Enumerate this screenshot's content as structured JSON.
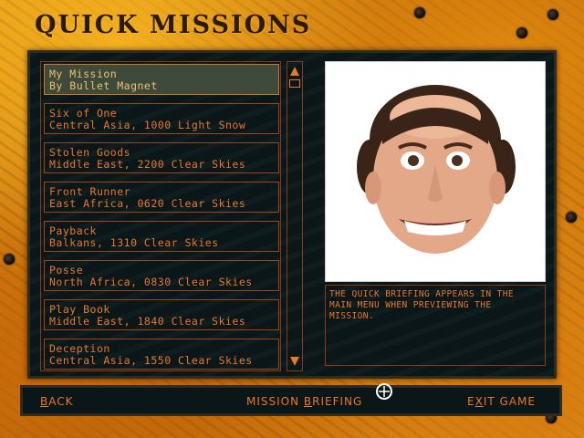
{
  "title": "QUICK MISSIONS",
  "missions": [
    {
      "name": "My Mission",
      "details": "By Bullet Magnet",
      "selected": true
    },
    {
      "name": "Six of One",
      "details": "Central Asia, 1000 Light Snow",
      "selected": false
    },
    {
      "name": "Stolen Goods",
      "details": "Middle East, 2200 Clear Skies",
      "selected": false
    },
    {
      "name": "Front Runner",
      "details": "East Africa, 0620 Clear Skies",
      "selected": false
    },
    {
      "name": "Payback",
      "details": "Balkans, 1310 Clear Skies",
      "selected": false
    },
    {
      "name": "Posse",
      "details": "North Africa, 0830 Clear Skies",
      "selected": false
    },
    {
      "name": "Play Book",
      "details": "Middle East, 1840 Clear Skies",
      "selected": false
    },
    {
      "name": "Deception",
      "details": "Central Asia, 1550 Clear Skies",
      "selected": false
    }
  ],
  "briefing_text": "THE QUICK BRIEFING APPEARS IN THE MAIN MENU WHEN PREVIEWING THE MISSION.",
  "buttons": {
    "back": {
      "first": "B",
      "rest": "ACK"
    },
    "mission_briefing": {
      "pre": "MISSION ",
      "first": "B",
      "rest": "RIEFING"
    },
    "exit_game": {
      "pre": "E",
      "first": "X",
      "rest": "IT GAME"
    }
  },
  "icons": {
    "scroll_up": "triangle-up-icon",
    "scroll_down": "triangle-down-icon",
    "cursor": "crosshair-cursor-icon"
  },
  "colors": {
    "accent": "#e8782a",
    "panel": "#0b1618",
    "frame": "#d88a14",
    "selected_row": "#3e4a3a"
  }
}
